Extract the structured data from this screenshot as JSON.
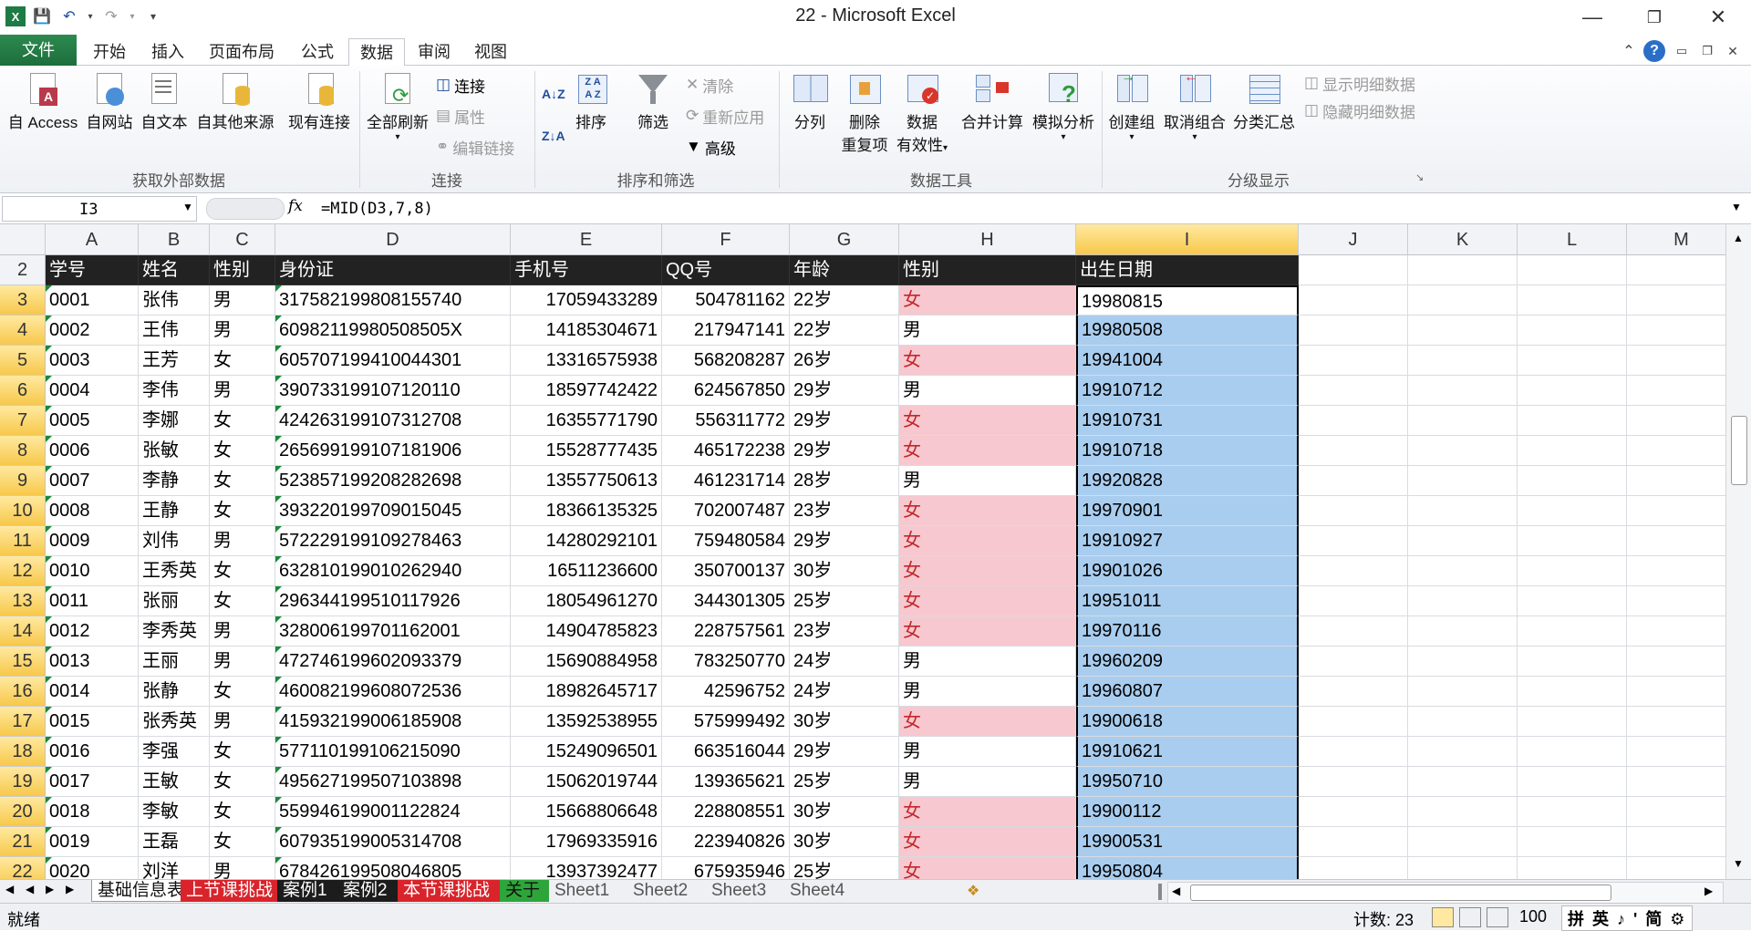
{
  "window": {
    "title": "22 - Microsoft Excel"
  },
  "tabs": [
    {
      "label": "文件"
    },
    {
      "label": "开始"
    },
    {
      "label": "插入"
    },
    {
      "label": "页面布局"
    },
    {
      "label": "公式"
    },
    {
      "label": "数据"
    },
    {
      "label": "审阅"
    },
    {
      "label": "视图"
    }
  ],
  "ribbon": {
    "ext": {
      "access": "自 Access",
      "web": "自网站",
      "text": "自文本",
      "other": "自其他来源",
      "existing": "现有连接",
      "group": "获取外部数据"
    },
    "conn": {
      "refresh": "全部刷新",
      "connect": "连接",
      "props": "属性",
      "editlinks": "编辑链接",
      "group": "连接"
    },
    "sort": {
      "sort": "排序",
      "filter": "筛选",
      "clear": "清除",
      "reapply": "重新应用",
      "advanced": "高级",
      "group": "排序和筛选"
    },
    "tools": {
      "split": "分列",
      "dedupe1": "删除",
      "dedupe2": "重复项",
      "valid1": "数据",
      "valid2": "有效性",
      "consolidate": "合并计算",
      "whatif": "模拟分析",
      "group": "数据工具"
    },
    "outline": {
      "group_btn": "创建组",
      "ungroup": "取消组合",
      "subtotal": "分类汇总",
      "show": "显示明细数据",
      "hide": "隐藏明细数据",
      "group": "分级显示"
    }
  },
  "formula_bar": {
    "name_box": "I3",
    "fx": "fx",
    "formula": "=MID(D3,7,8)"
  },
  "columns": [
    "A",
    "B",
    "C",
    "D",
    "E",
    "F",
    "G",
    "H",
    "I",
    "J",
    "K",
    "L",
    "M"
  ],
  "header_row": {
    "row": "2",
    "cells": [
      "学号",
      "姓名",
      "性别",
      "身份证",
      "手机号",
      "QQ号",
      "年龄",
      "性别",
      "出生日期"
    ]
  },
  "rows": [
    {
      "r": "3",
      "id": "0001",
      "name": "张伟",
      "sex": "男",
      "idcard": "317582199808155740",
      "phone": "17059433289",
      "qq": "504781162",
      "age": "22岁",
      "sex2": "女",
      "birth": "19980815"
    },
    {
      "r": "4",
      "id": "0002",
      "name": "王伟",
      "sex": "男",
      "idcard": "60982119980508505X",
      "phone": "14185304671",
      "qq": "217947141",
      "age": "22岁",
      "sex2": "男",
      "birth": "19980508"
    },
    {
      "r": "5",
      "id": "0003",
      "name": "王芳",
      "sex": "女",
      "idcard": "605707199410044301",
      "phone": "13316575938",
      "qq": "568208287",
      "age": "26岁",
      "sex2": "女",
      "birth": "19941004"
    },
    {
      "r": "6",
      "id": "0004",
      "name": "李伟",
      "sex": "男",
      "idcard": "390733199107120110",
      "phone": "18597742422",
      "qq": "624567850",
      "age": "29岁",
      "sex2": "男",
      "birth": "19910712"
    },
    {
      "r": "7",
      "id": "0005",
      "name": "李娜",
      "sex": "女",
      "idcard": "424263199107312708",
      "phone": "16355771790",
      "qq": "556311772",
      "age": "29岁",
      "sex2": "女",
      "birth": "19910731"
    },
    {
      "r": "8",
      "id": "0006",
      "name": "张敏",
      "sex": "女",
      "idcard": "265699199107181906",
      "phone": "15528777435",
      "qq": "465172238",
      "age": "29岁",
      "sex2": "女",
      "birth": "19910718"
    },
    {
      "r": "9",
      "id": "0007",
      "name": "李静",
      "sex": "女",
      "idcard": "523857199208282698",
      "phone": "13557750613",
      "qq": "461231714",
      "age": "28岁",
      "sex2": "男",
      "birth": "19920828"
    },
    {
      "r": "10",
      "id": "0008",
      "name": "王静",
      "sex": "女",
      "idcard": "393220199709015045",
      "phone": "18366135325",
      "qq": "702007487",
      "age": "23岁",
      "sex2": "女",
      "birth": "19970901"
    },
    {
      "r": "11",
      "id": "0009",
      "name": "刘伟",
      "sex": "男",
      "idcard": "572229199109278463",
      "phone": "14280292101",
      "qq": "759480584",
      "age": "29岁",
      "sex2": "女",
      "birth": "19910927"
    },
    {
      "r": "12",
      "id": "0010",
      "name": "王秀英",
      "sex": "女",
      "idcard": "632810199010262940",
      "phone": "16511236600",
      "qq": "350700137",
      "age": "30岁",
      "sex2": "女",
      "birth": "19901026"
    },
    {
      "r": "13",
      "id": "0011",
      "name": "张丽",
      "sex": "女",
      "idcard": "296344199510117926",
      "phone": "18054961270",
      "qq": "344301305",
      "age": "25岁",
      "sex2": "女",
      "birth": "19951011"
    },
    {
      "r": "14",
      "id": "0012",
      "name": "李秀英",
      "sex": "男",
      "idcard": "328006199701162001",
      "phone": "14904785823",
      "qq": "228757561",
      "age": "23岁",
      "sex2": "女",
      "birth": "19970116"
    },
    {
      "r": "15",
      "id": "0013",
      "name": "王丽",
      "sex": "男",
      "idcard": "472746199602093379",
      "phone": "15690884958",
      "qq": "783250770",
      "age": "24岁",
      "sex2": "男",
      "birth": "19960209"
    },
    {
      "r": "16",
      "id": "0014",
      "name": "张静",
      "sex": "女",
      "idcard": "460082199608072536",
      "phone": "18982645717",
      "qq": "42596752",
      "age": "24岁",
      "sex2": "男",
      "birth": "19960807"
    },
    {
      "r": "17",
      "id": "0015",
      "name": "张秀英",
      "sex": "男",
      "idcard": "415932199006185908",
      "phone": "13592538955",
      "qq": "575999492",
      "age": "30岁",
      "sex2": "女",
      "birth": "19900618"
    },
    {
      "r": "18",
      "id": "0016",
      "name": "李强",
      "sex": "女",
      "idcard": "577110199106215090",
      "phone": "15249096501",
      "qq": "663516044",
      "age": "29岁",
      "sex2": "男",
      "birth": "19910621"
    },
    {
      "r": "19",
      "id": "0017",
      "name": "王敏",
      "sex": "女",
      "idcard": "495627199507103898",
      "phone": "15062019744",
      "qq": "139365621",
      "age": "25岁",
      "sex2": "男",
      "birth": "19950710"
    },
    {
      "r": "20",
      "id": "0018",
      "name": "李敏",
      "sex": "女",
      "idcard": "559946199001122824",
      "phone": "15668806648",
      "qq": "228808551",
      "age": "30岁",
      "sex2": "女",
      "birth": "19900112"
    },
    {
      "r": "21",
      "id": "0019",
      "name": "王磊",
      "sex": "女",
      "idcard": "607935199005314708",
      "phone": "17969335916",
      "qq": "223940826",
      "age": "30岁",
      "sex2": "女",
      "birth": "19900531"
    },
    {
      "r": "22",
      "id": "0020",
      "name": "刘洋",
      "sex": "男",
      "idcard": "678426199508046805",
      "phone": "13937392477",
      "qq": "675935946",
      "age": "25岁",
      "sex2": "女",
      "birth": "19950804"
    }
  ],
  "sheets": [
    {
      "label": "基础信息表",
      "style": "active"
    },
    {
      "label": "上节课挑战",
      "style": "red"
    },
    {
      "label": "案例1",
      "style": "black"
    },
    {
      "label": "案例2",
      "style": "black"
    },
    {
      "label": "本节课挑战",
      "style": "red"
    },
    {
      "label": "关于",
      "style": "green"
    },
    {
      "label": "Sheet1",
      "style": "plain"
    },
    {
      "label": "Sheet2",
      "style": "plain"
    },
    {
      "label": "Sheet3",
      "style": "plain"
    },
    {
      "label": "Sheet4",
      "style": "plain"
    }
  ],
  "status": {
    "ready": "就绪",
    "count": "计数: 23",
    "zoom": "100",
    "ime": "拼 英 ♪ ' 简 ⚙"
  },
  "colors": {
    "pink": "#f7c8cf",
    "blue": "#a9cdef",
    "header_bg": "#222222",
    "file_tab": "#217346"
  }
}
